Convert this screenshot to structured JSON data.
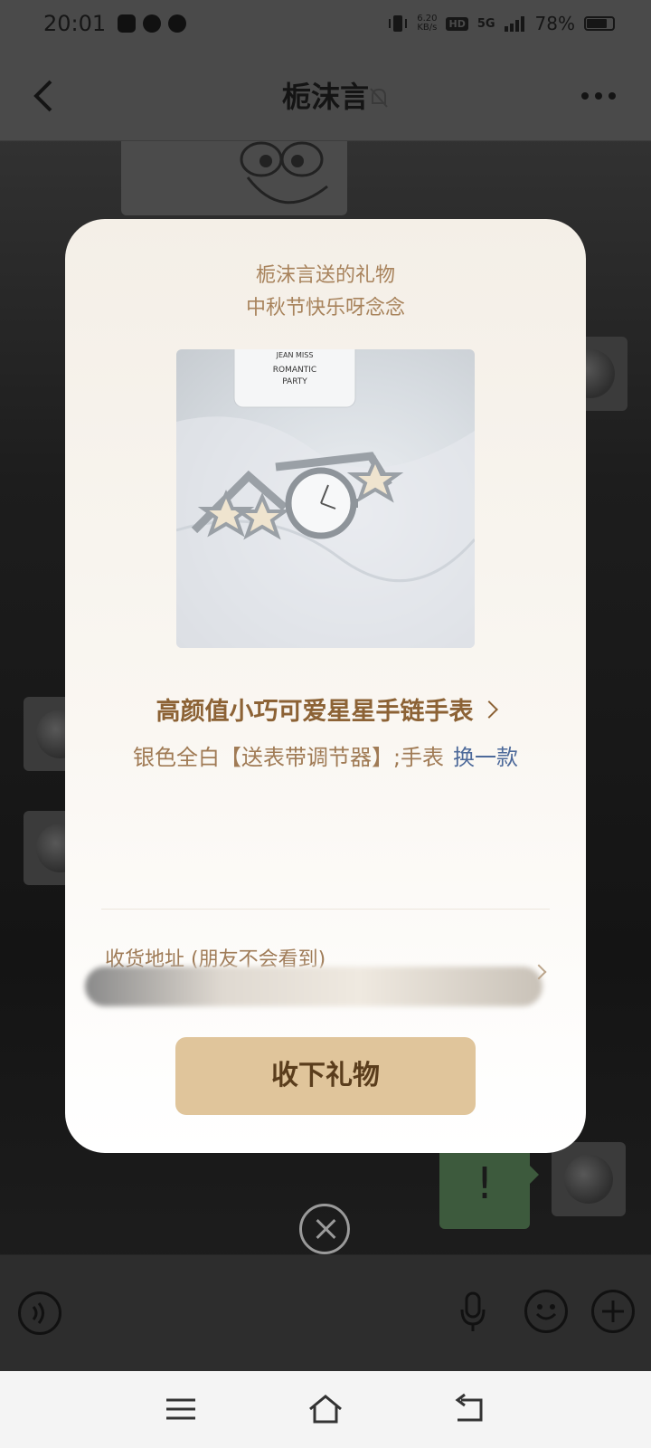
{
  "status_bar": {
    "time": "20:01",
    "net_speed_value": "6.20",
    "net_speed_unit": "KB/s",
    "hd_badge": "HD",
    "network": "5G",
    "battery_text": "78%"
  },
  "chat_header": {
    "title": "栀沫言"
  },
  "chat": {
    "green_bubble_text": "!"
  },
  "gift_dialog": {
    "from_text": "栀沫言送的礼物",
    "message": "中秋节快乐呀念念",
    "product": {
      "photo_text_brand": "JEAN MISS",
      "photo_text_line1": "ROMANTIC",
      "photo_text_line2": "PARTY",
      "name": "高颜值小巧可爱星星手链手表",
      "variant": "银色全白【送表带调节器】;手表",
      "swap_label": "换一款"
    },
    "address_label": "收货地址 (朋友不会看到)",
    "accept_button": "收下礼物"
  },
  "colors": {
    "dialog_title": "#a8835c",
    "product_name": "#8c6235",
    "swap_link": "#4d6a9a",
    "accept_button_bg": "#e0c59b"
  },
  "icons": {
    "back": "back-chevron-icon",
    "mute": "bell-muted-icon",
    "more": "more-dots-icon",
    "voice": "voice-icon",
    "mic": "mic-icon",
    "emoji": "emoji-icon",
    "add": "plus-icon",
    "close": "close-icon",
    "nav_menu": "menu-icon",
    "nav_home": "home-icon",
    "nav_back": "back-icon"
  }
}
